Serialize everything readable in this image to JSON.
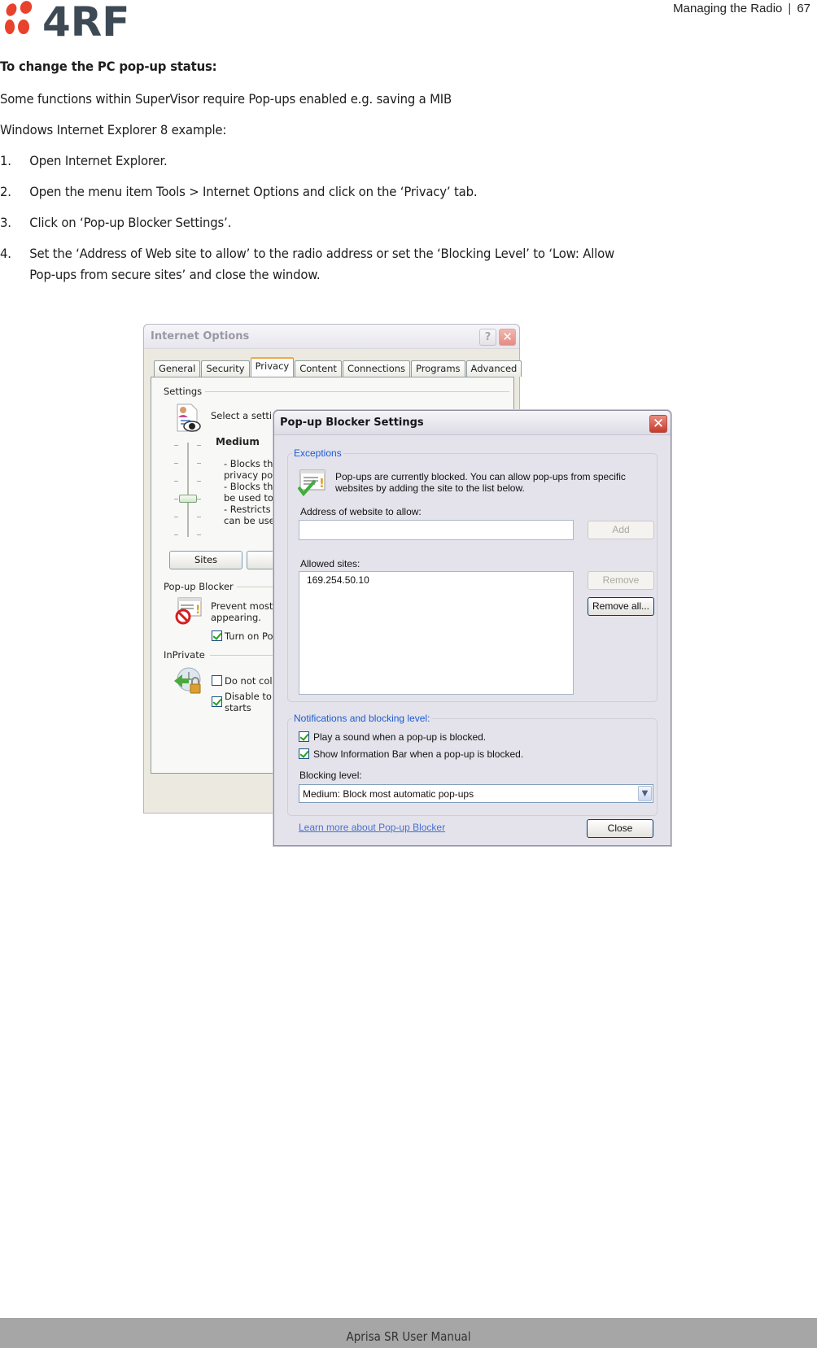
{
  "header": {
    "logo_text": "4RF",
    "section": "Managing the Radio",
    "page_number": "67",
    "brand_colors": {
      "dots": "#e8412c",
      "text": "#3d4a55"
    }
  },
  "content": {
    "heading": "To change the PC pop-up status:",
    "intro": "Some functions within SuperVisor require Pop-ups enabled e.g. saving a MIB",
    "example_label": "Windows Internet Explorer 8 example:",
    "steps": [
      {
        "num": "1.",
        "text": "Open Internet Explorer."
      },
      {
        "num": "2.",
        "text": "Open the menu item Tools > Internet Options and click on the ‘Privacy’ tab."
      },
      {
        "num": "3.",
        "text": "Click on ‘Pop-up Blocker Settings’."
      },
      {
        "num": "4.",
        "text": "Set the ‘Address of Web site to allow’ to the radio address or set the ‘Blocking Level’ to ‘Low: Allow",
        "text2": "Pop-ups from secure sites’ and close the window."
      }
    ]
  },
  "internet_options": {
    "title": "Internet Options",
    "help_icon": "?",
    "close_icon": "✕",
    "tabs": [
      {
        "label": "General",
        "active": false
      },
      {
        "label": "Security",
        "active": false
      },
      {
        "label": "Privacy",
        "active": true
      },
      {
        "label": "Content",
        "active": false
      },
      {
        "label": "Connections",
        "active": false
      },
      {
        "label": "Programs",
        "active": false
      },
      {
        "label": "Advanced",
        "active": false
      }
    ],
    "settings": {
      "group_label": "Settings",
      "select_text": "Select a setting for",
      "level": "Medium",
      "level_value": "Medium",
      "description_lines": [
        "- Blocks thi",
        "privacy po",
        "- Blocks thi",
        "be used to",
        "- Restricts",
        "can be use"
      ],
      "sites_button": "Sites"
    },
    "popup_blocker": {
      "group_label": "Pop-up Blocker",
      "description_lines": [
        "Prevent most",
        "appearing."
      ],
      "turn_on_label": "Turn on Po",
      "turn_on_checked": true
    },
    "inprivate": {
      "group_label": "InPrivate",
      "do_not_collect_label": "Do not col",
      "do_not_collect_checked": false,
      "disable_toolbars_label_lines": [
        "Disable to",
        "starts"
      ],
      "disable_toolbars_checked": true
    }
  },
  "popup_blocker_settings": {
    "title": "Pop-up Blocker Settings",
    "close_icon": "✕",
    "exceptions": {
      "legend": "Exceptions",
      "info_lines": [
        "Pop-ups are currently blocked.  You can allow pop-ups from specific",
        "websites by adding the site to the list below."
      ],
      "address_label": "Address of website to allow:",
      "address_value": "",
      "add_button": "Add",
      "allowed_label": "Allowed sites:",
      "allowed_sites": [
        "169.254.50.10"
      ],
      "remove_button": "Remove",
      "remove_all_button": "Remove all..."
    },
    "notifications": {
      "legend": "Notifications and blocking level:",
      "play_sound_label": "Play a sound when a pop-up is blocked.",
      "play_sound_checked": true,
      "show_info_bar_label": "Show Information Bar when a pop-up is blocked.",
      "show_info_bar_checked": true,
      "blocking_level_label": "Blocking level:",
      "blocking_level_value": "Medium: Block most automatic pop-ups"
    },
    "learn_more_link": "Learn more about Pop-up Blocker",
    "close_button": "Close",
    "legend_color": "#1d5bd1"
  },
  "footer": {
    "text": "Aprisa SR User Manual"
  }
}
